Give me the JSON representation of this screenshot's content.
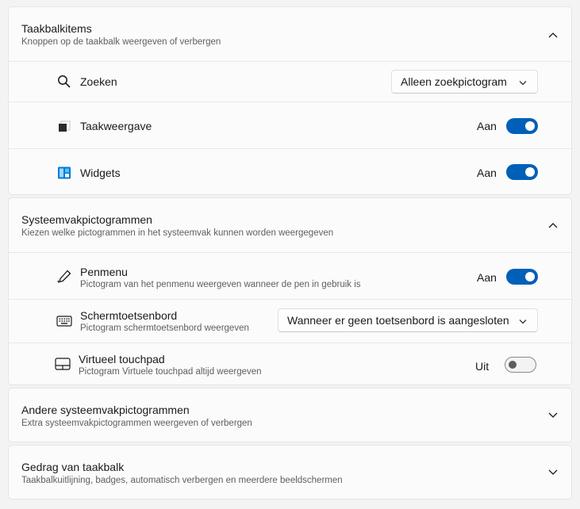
{
  "taskbar_items": {
    "title": "Taakbalkitems",
    "subtitle": "Knoppen op de taakbalk weergeven of verbergen",
    "expanded": true,
    "items": [
      {
        "label": "Zoeken",
        "icon": "search-icon",
        "control": "dropdown",
        "value": "Alleen zoekpictogram"
      },
      {
        "label": "Taakweergave",
        "icon": "task-view-icon",
        "control": "toggle",
        "state": "Aan",
        "on": true
      },
      {
        "label": "Widgets",
        "icon": "widgets-icon",
        "control": "toggle",
        "state": "Aan",
        "on": true
      }
    ]
  },
  "system_tray_icons": {
    "title": "Systeemvakpictogrammen",
    "subtitle": "Kiezen welke pictogrammen in het systeemvak kunnen worden weergegeven",
    "expanded": true,
    "items": [
      {
        "label": "Penmenu",
        "description": "Pictogram van het penmenu weergeven wanneer de pen in gebruik is",
        "icon": "pen-icon",
        "control": "toggle",
        "state": "Aan",
        "on": true
      },
      {
        "label": "Schermtoetsenbord",
        "description": "Pictogram schermtoetsenbord weergeven",
        "icon": "keyboard-icon",
        "control": "dropdown",
        "value": "Wanneer er geen toetsenbord is aangesloten"
      },
      {
        "label": "Virtueel touchpad",
        "description": "Pictogram Virtuele touchpad altijd weergeven",
        "icon": "touchpad-icon",
        "control": "toggle",
        "state": "Uit",
        "on": false
      }
    ]
  },
  "other_tray_icons": {
    "title": "Andere systeemvakpictogrammen",
    "subtitle": "Extra systeemvakpictogrammen weergeven of verbergen",
    "expanded": false
  },
  "taskbar_behaviors": {
    "title": "Gedrag van taakbalk",
    "subtitle": "Taakbalkuitlijning, badges, automatisch verbergen en meerdere beeldschermen",
    "expanded": false
  },
  "colors": {
    "accent": "#005fb8",
    "background": "#f3f3f3",
    "card": "#fbfbfb"
  }
}
